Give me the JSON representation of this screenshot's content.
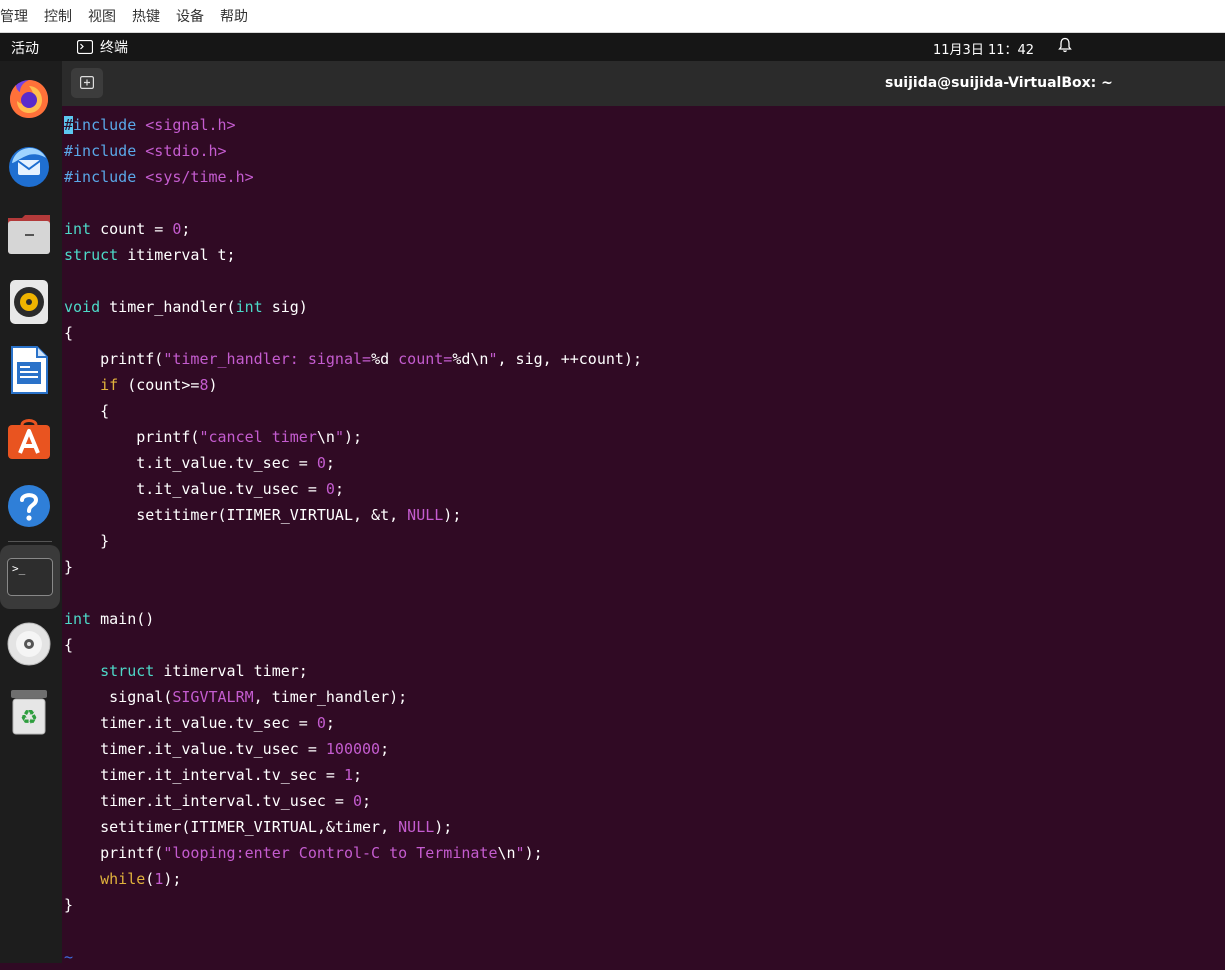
{
  "vbox_menu": [
    "管理",
    "控制",
    "视图",
    "热键",
    "设备",
    "帮助"
  ],
  "topbar": {
    "activities": "活动",
    "app_name": "终端",
    "clock": "11月3日  11：42"
  },
  "dock": {
    "apps": [
      "firefox",
      "thunderbird",
      "files",
      "rhythmbox",
      "libreoffice-writer",
      "software-center",
      "help",
      "terminal",
      "dvd-drive",
      "trash"
    ]
  },
  "terminal": {
    "title": "suijida@suijida-VirtualBox: ~",
    "code": {
      "l01_pp_cursor": "#",
      "l01_pp": "include",
      "l01_hdr": "<signal.h>",
      "l02_pp": "#include",
      "l02_hdr": "<stdio.h>",
      "l03_pp": "#include",
      "l03_hdr": "<sys/time.h>",
      "l05_type": "int",
      "l05_a": " count = ",
      "l05_num": "0",
      "l05_b": ";",
      "l06_type": "struct",
      "l06_a": " itimerval t;",
      "l08_type": "void",
      "l08_a": " timer_handler(",
      "l08_type2": "int",
      "l08_b": " sig)",
      "l09": "{",
      "l10_a": "    printf(",
      "l10_str1": "\"timer_handler: signal=",
      "l10_fmt1": "%d",
      "l10_str2": " count=",
      "l10_fmt2": "%d\\n",
      "l10_str3": "\"",
      "l10_b": ", sig, ++count);",
      "l11_ind": "    ",
      "l11_kw": "if",
      "l11_a": " (count>=",
      "l11_num": "8",
      "l11_b": ")",
      "l12": "    {",
      "l13_a": "        printf(",
      "l13_str1": "\"cancel timer",
      "l13_esc": "\\n",
      "l13_str2": "\"",
      "l13_b": ");",
      "l14_a": "        t.it_value.tv_sec = ",
      "l14_num": "0",
      "l14_b": ";",
      "l15_a": "        t.it_value.tv_usec = ",
      "l15_num": "0",
      "l15_b": ";",
      "l16_a": "        setitimer(ITIMER_VIRTUAL, &t, ",
      "l16_null": "NULL",
      "l16_b": ");",
      "l17": "    }",
      "l18": "}",
      "l20_type": "int",
      "l20_a": " main()",
      "l21": "{",
      "l22_ind": "    ",
      "l22_type": "struct",
      "l22_a": " itimerval timer;",
      "l23_a": "     signal(",
      "l23_const": "SIGVTALRM",
      "l23_b": ", timer_handler);",
      "l24_a": "    timer.it_value.tv_sec = ",
      "l24_num": "0",
      "l24_b": ";",
      "l25_a": "    timer.it_value.tv_usec = ",
      "l25_num": "100000",
      "l25_b": ";",
      "l26_a": "    timer.it_interval.tv_sec = ",
      "l26_num": "1",
      "l26_b": ";",
      "l27_a": "    timer.it_interval.tv_usec = ",
      "l27_num": "0",
      "l27_b": ";",
      "l28_a": "    setitimer(ITIMER_VIRTUAL,&timer, ",
      "l28_null": "NULL",
      "l28_b": ");",
      "l29_a": "    printf(",
      "l29_str1": "\"looping:enter Control-C to Terminate",
      "l29_esc": "\\n",
      "l29_str2": "\"",
      "l29_b": ");",
      "l30_ind": "    ",
      "l30_kw": "while",
      "l30_a": "(",
      "l30_num": "1",
      "l30_b": ");",
      "l31": "}",
      "tilde": "~"
    }
  }
}
